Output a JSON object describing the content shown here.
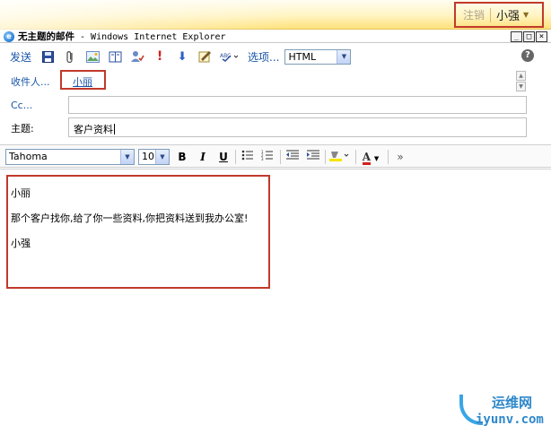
{
  "banner": {
    "logout": "注销",
    "username": "小强"
  },
  "window": {
    "title_cn": "无主题的邮件",
    "title_rest": " - Windows Internet Explorer",
    "buttons": [
      "_",
      "□",
      "×"
    ]
  },
  "toolbar": {
    "send": "发送",
    "options": "选项...",
    "format": "HTML",
    "help": "?"
  },
  "fields": {
    "to_label": "收件人...",
    "to_value": "小丽",
    "cc_label": "Cc...",
    "subject_label": "主题:",
    "subject_value": "客户资料"
  },
  "format_bar": {
    "font": "Tahoma",
    "size": "10",
    "bold": "B",
    "italic": "I",
    "underline": "U",
    "font_color": "A"
  },
  "message": {
    "line1": "小丽",
    "line2": "那个客户找你,给了你一些资料,你把资料送到我办公室!",
    "line3": "小强"
  },
  "watermark": {
    "name": "运维网",
    "url": "iyunv.com"
  },
  "colors": {
    "highlight": "#c0392b",
    "link": "#1a56a8"
  }
}
